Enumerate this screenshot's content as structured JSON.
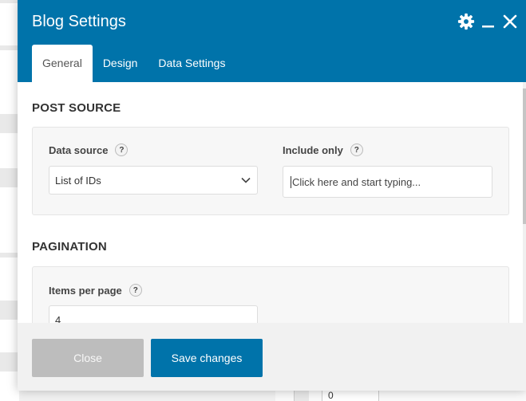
{
  "modal": {
    "title": "Blog Settings",
    "header_icons": [
      "gear-icon",
      "minimize-icon",
      "close-icon"
    ],
    "tabs": [
      {
        "label": "General",
        "active": true
      },
      {
        "label": "Design",
        "active": false
      },
      {
        "label": "Data Settings",
        "active": false
      }
    ]
  },
  "post_source": {
    "section_title": "POST SOURCE",
    "data_source": {
      "label": "Data source",
      "help": "?",
      "value": "List of IDs"
    },
    "include_only": {
      "label": "Include only",
      "help": "?",
      "placeholder": "Click here and start typing..."
    }
  },
  "pagination": {
    "section_title": "PAGINATION",
    "items_per_page": {
      "label": "Items per page",
      "help": "?",
      "value": "4"
    }
  },
  "footer": {
    "close_label": "Close",
    "save_label": "Save changes"
  },
  "background": {
    "cell_value": "0"
  },
  "colors": {
    "accent": "#0073aa",
    "disabled_button": "#bdbdbd",
    "section_bg": "#f7f7f7",
    "footer_bg": "#f1f1f1"
  }
}
